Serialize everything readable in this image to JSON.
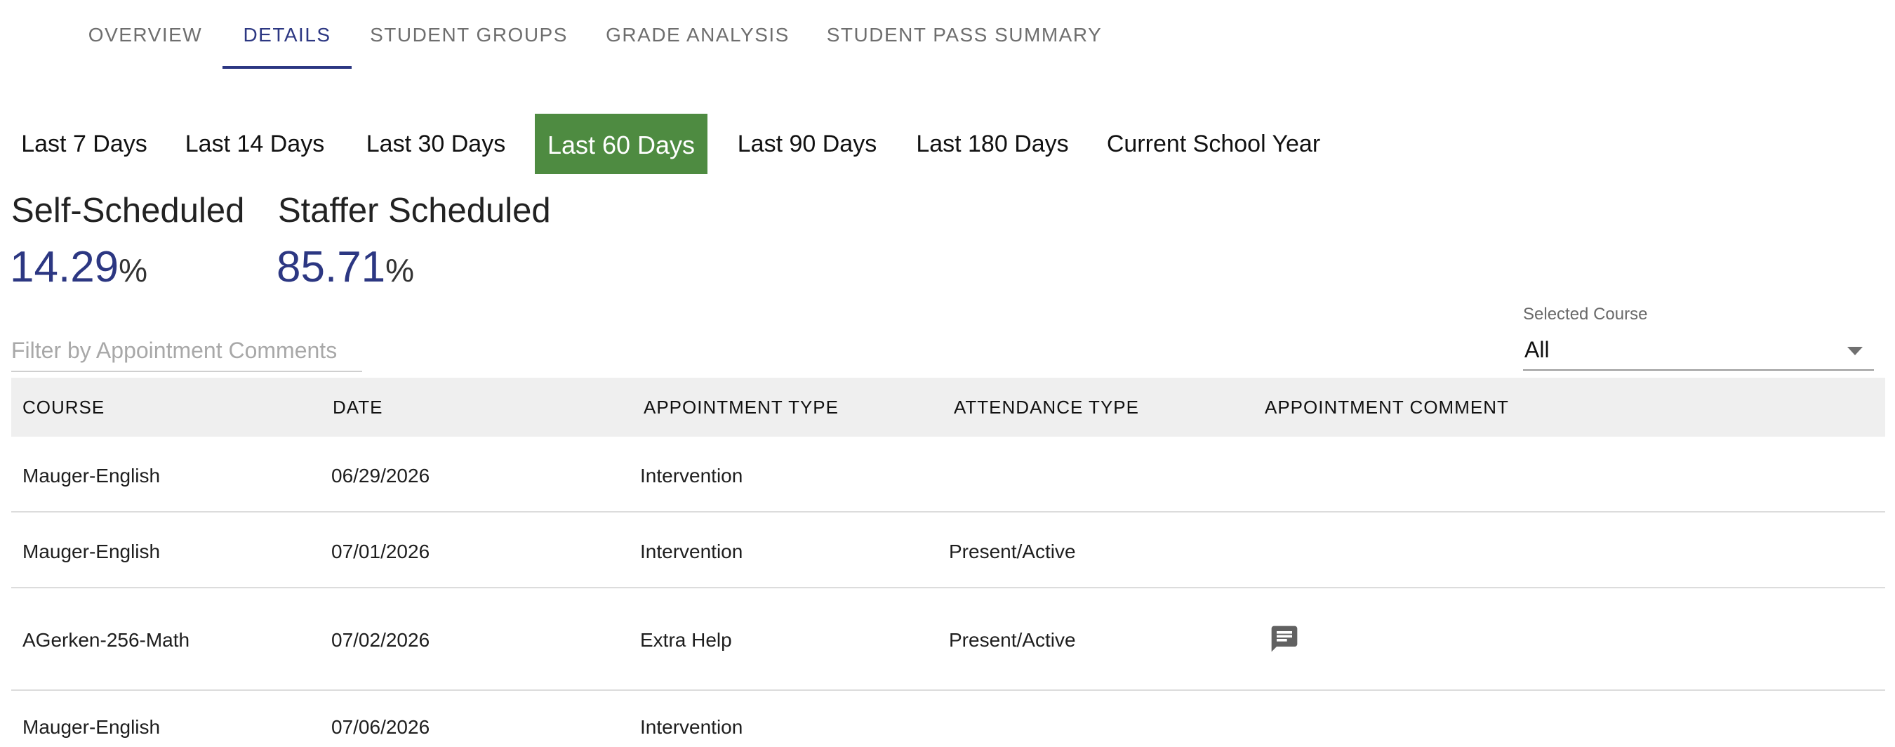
{
  "nav": {
    "tabs": [
      {
        "label": "OVERVIEW"
      },
      {
        "label": "DETAILS"
      },
      {
        "label": "STUDENT GROUPS"
      },
      {
        "label": "GRADE ANALYSIS"
      },
      {
        "label": "STUDENT PASS SUMMARY"
      }
    ],
    "active_tab": "DETAILS"
  },
  "date_ranges": {
    "options": [
      {
        "label": "Last 7 Days"
      },
      {
        "label": "Last 14 Days"
      },
      {
        "label": "Last 30 Days"
      },
      {
        "label": "Last 60 Days"
      },
      {
        "label": "Last 90 Days"
      },
      {
        "label": "Last 180 Days"
      },
      {
        "label": "Current School Year"
      }
    ],
    "selected": "Last 60 Days",
    "selected_color": "#4e8b41"
  },
  "stats": {
    "self_scheduled": {
      "label": "Self-Scheduled",
      "value": "14.29",
      "unit": "%"
    },
    "staffer_scheduled": {
      "label": "Staffer Scheduled",
      "value": "85.71",
      "unit": "%"
    },
    "value_color": "#2c3782"
  },
  "filter": {
    "placeholder": "Filter by Appointment Comments",
    "value": ""
  },
  "course_select": {
    "label": "Selected Course",
    "value": "All"
  },
  "table": {
    "headers": [
      "COURSE",
      "DATE",
      "APPOINTMENT TYPE",
      "ATTENDANCE TYPE",
      "APPOINTMENT COMMENT"
    ],
    "rows": [
      {
        "course": "Mauger-English",
        "date": "06/29/2026",
        "appointment_type": "Intervention",
        "attendance_type": "",
        "has_comment": false
      },
      {
        "course": "Mauger-English",
        "date": "07/01/2026",
        "appointment_type": "Intervention",
        "attendance_type": "Present/Active",
        "has_comment": false
      },
      {
        "course": "AGerken-256-Math",
        "date": "07/02/2026",
        "appointment_type": "Extra Help",
        "attendance_type": "Present/Active",
        "has_comment": true
      },
      {
        "course": "Mauger-English",
        "date": "07/06/2026",
        "appointment_type": "Intervention",
        "attendance_type": "",
        "has_comment": false
      }
    ],
    "comment_icon": "comment-icon"
  }
}
